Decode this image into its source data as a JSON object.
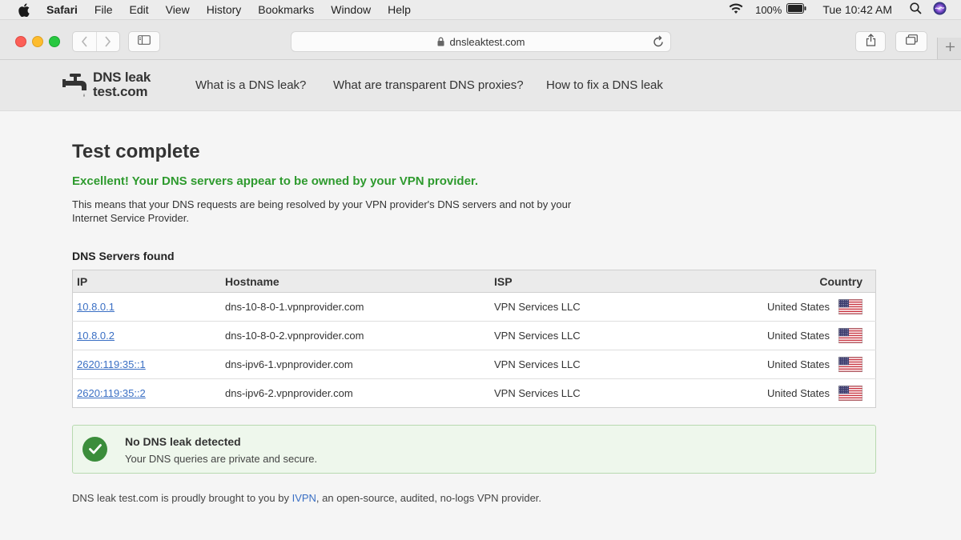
{
  "menubar": {
    "app_name": "Safari",
    "items": [
      "File",
      "Edit",
      "View",
      "History",
      "Bookmarks",
      "Window",
      "Help"
    ],
    "battery_percent": "100%",
    "clock": "Tue 10:42 AM"
  },
  "browser": {
    "url": "dnsleaktest.com"
  },
  "site": {
    "logo_line1": "DNS leak",
    "logo_line2": "test.com",
    "nav": [
      "What is a DNS leak?",
      "What are transparent DNS proxies?",
      "How to fix a DNS leak"
    ]
  },
  "main": {
    "title": "Test complete",
    "headline": "Excellent! Your DNS servers appear to be owned by your VPN provider.",
    "description": "This means that your DNS requests are being resolved by your VPN provider's DNS servers and not by your Internet Service Provider.",
    "section_title": "DNS Servers found",
    "table": {
      "headers": [
        "IP",
        "Hostname",
        "ISP",
        "Country"
      ],
      "rows": [
        {
          "ip": "10.8.0.1",
          "hostname": "dns-10-8-0-1.vpnprovider.com",
          "isp": "VPN Services LLC",
          "country": "United States"
        },
        {
          "ip": "10.8.0.2",
          "hostname": "dns-10-8-0-2.vpnprovider.com",
          "isp": "VPN Services LLC",
          "country": "United States"
        },
        {
          "ip": "2620:119:35::1",
          "hostname": "dns-ipv6-1.vpnprovider.com",
          "isp": "VPN Services LLC",
          "country": "United States"
        },
        {
          "ip": "2620:119:35::2",
          "hostname": "dns-ipv6-2.vpnprovider.com",
          "isp": "VPN Services LLC",
          "country": "United States"
        }
      ]
    },
    "status": {
      "title": "No DNS leak detected",
      "subtitle": "Your DNS queries are private and secure."
    },
    "footer": {
      "prefix": "DNS leak test.com is proudly brought to you by ",
      "link": "IVPN",
      "suffix": ", an open-source, audited, no-logs VPN provider."
    }
  },
  "colors": {
    "success_green": "#2e9a2e",
    "link_blue": "#3a6fc4"
  }
}
